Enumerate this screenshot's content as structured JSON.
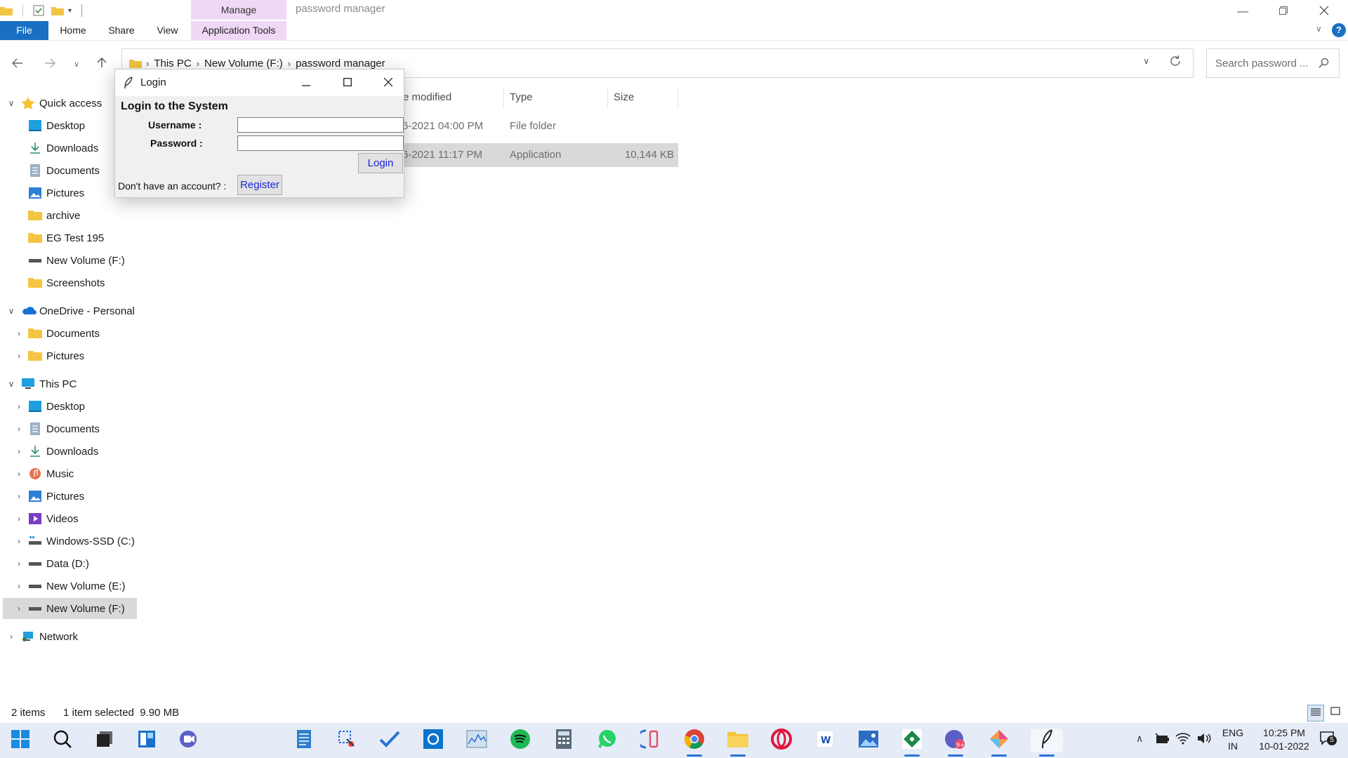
{
  "window": {
    "title": "password manager",
    "context_tab": "Manage"
  },
  "ribbon": {
    "tabs": [
      "File",
      "Home",
      "Share",
      "View",
      "Application Tools"
    ]
  },
  "address": {
    "crumbs": [
      "This PC",
      "New Volume (F:)",
      "password manager"
    ]
  },
  "search": {
    "placeholder": "Search password ..."
  },
  "nav": {
    "quick_access": {
      "label": "Quick access",
      "items": [
        "Desktop",
        "Downloads",
        "Documents",
        "Pictures",
        "archive",
        "EG Test 195",
        "New Volume (F:)",
        "Screenshots"
      ]
    },
    "onedrive": {
      "label": "OneDrive - Personal",
      "items": [
        "Documents",
        "Pictures"
      ]
    },
    "this_pc": {
      "label": "This PC",
      "items": [
        "Desktop",
        "Documents",
        "Downloads",
        "Music",
        "Pictures",
        "Videos",
        "Windows-SSD (C:)",
        "Data (D:)",
        "New Volume (E:)",
        "New Volume (F:)"
      ]
    },
    "network": {
      "label": "Network"
    }
  },
  "filelist": {
    "columns": [
      "e modified",
      "Type",
      "Size"
    ],
    "rows": [
      {
        "date": "6-2021 04:00 PM",
        "type": "File folder",
        "size": ""
      },
      {
        "date": "6-2021 11:17 PM",
        "type": "Application",
        "size": "10,144 KB"
      }
    ]
  },
  "status": {
    "items_count": "2 items",
    "selection": "1 item selected  9.90 MB"
  },
  "login": {
    "title": "Login",
    "heading": "Login to the System",
    "username_label": "Username :",
    "password_label": "Password :",
    "username_value": "",
    "password_value": "",
    "login_button": "Login",
    "register_prompt": "Don't have an account? :",
    "register_button": "Register"
  },
  "taskbar": {
    "lang_top": "ENG",
    "lang_bottom": "IN",
    "time": "10:25 PM",
    "date": "10-01-2022",
    "notif_count": "5"
  },
  "colors": {
    "accent": "#1a6fc4",
    "manage_tab": "#efd8f6",
    "selection": "#d9d9d9",
    "dialog_button_text": "#1b27d8",
    "taskbar": "#e6ecf7"
  }
}
